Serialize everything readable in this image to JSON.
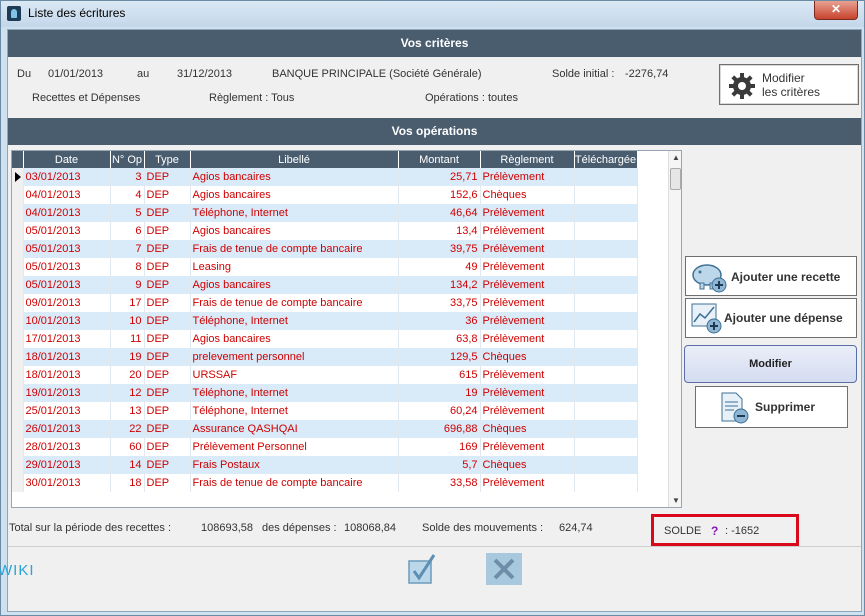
{
  "window": {
    "title": "Liste des écritures",
    "close_label": "✕"
  },
  "criteria": {
    "header": "Vos critères",
    "du_label": "Du",
    "du_value": "01/01/2013",
    "au_label": "au",
    "au_value": "31/12/2013",
    "bank": "BANQUE PRINCIPALE (Société Générale)",
    "solde_initial_label": "Solde initial :",
    "solde_initial_value": "-2276,74",
    "type": "Recettes et Dépenses",
    "reglement": "Règlement : Tous",
    "operations": "Opérations : toutes",
    "modify_button": "Modifier\nles critères"
  },
  "operations": {
    "header": "Vos opérations",
    "columns": [
      "Date",
      "N° Op",
      "Type",
      "Libellé",
      "Montant",
      "Règlement",
      "Téléchargée"
    ],
    "rows": [
      {
        "date": "03/01/2013",
        "op": "3",
        "type": "DEP",
        "libelle": "Agios bancaires",
        "montant": "25,71",
        "reglement": "Prélèvement"
      },
      {
        "date": "04/01/2013",
        "op": "4",
        "type": "DEP",
        "libelle": "Agios bancaires",
        "montant": "152,6",
        "reglement": "Chèques"
      },
      {
        "date": "04/01/2013",
        "op": "5",
        "type": "DEP",
        "libelle": "Téléphone, Internet",
        "montant": "46,64",
        "reglement": "Prélèvement"
      },
      {
        "date": "05/01/2013",
        "op": "6",
        "type": "DEP",
        "libelle": "Agios bancaires",
        "montant": "13,4",
        "reglement": "Prélèvement"
      },
      {
        "date": "05/01/2013",
        "op": "7",
        "type": "DEP",
        "libelle": "Frais de tenue de compte bancaire",
        "montant": "39,75",
        "reglement": "Prélèvement"
      },
      {
        "date": "05/01/2013",
        "op": "8",
        "type": "DEP",
        "libelle": "Leasing",
        "montant": "49",
        "reglement": "Prélèvement"
      },
      {
        "date": "05/01/2013",
        "op": "9",
        "type": "DEP",
        "libelle": "Agios bancaires",
        "montant": "134,2",
        "reglement": "Prélèvement"
      },
      {
        "date": "09/01/2013",
        "op": "17",
        "type": "DEP",
        "libelle": "Frais de tenue de compte bancaire",
        "montant": "33,75",
        "reglement": "Prélèvement"
      },
      {
        "date": "10/01/2013",
        "op": "10",
        "type": "DEP",
        "libelle": "Téléphone, Internet",
        "montant": "36",
        "reglement": "Prélèvement"
      },
      {
        "date": "17/01/2013",
        "op": "11",
        "type": "DEP",
        "libelle": "Agios bancaires",
        "montant": "63,8",
        "reglement": "Prélèvement"
      },
      {
        "date": "18/01/2013",
        "op": "19",
        "type": "DEP",
        "libelle": "prelevement personnel",
        "montant": "129,5",
        "reglement": "Chèques"
      },
      {
        "date": "18/01/2013",
        "op": "20",
        "type": "DEP",
        "libelle": "URSSAF",
        "montant": "615",
        "reglement": "Prélèvement"
      },
      {
        "date": "19/01/2013",
        "op": "12",
        "type": "DEP",
        "libelle": "Téléphone, Internet",
        "montant": "19",
        "reglement": "Prélèvement"
      },
      {
        "date": "25/01/2013",
        "op": "13",
        "type": "DEP",
        "libelle": "Téléphone, Internet",
        "montant": "60,24",
        "reglement": "Prélèvement"
      },
      {
        "date": "26/01/2013",
        "op": "22",
        "type": "DEP",
        "libelle": "Assurance QASHQAI",
        "montant": "696,88",
        "reglement": "Chèques"
      },
      {
        "date": "28/01/2013",
        "op": "60",
        "type": "DEP",
        "libelle": "Prélèvement Personnel",
        "montant": "169",
        "reglement": "Prélèvement"
      },
      {
        "date": "29/01/2013",
        "op": "14",
        "type": "DEP",
        "libelle": "Frais Postaux",
        "montant": "5,7",
        "reglement": "Chèques"
      },
      {
        "date": "30/01/2013",
        "op": "18",
        "type": "DEP",
        "libelle": "Frais de tenue de compte bancaire",
        "montant": "33,58",
        "reglement": "Prélèvement"
      }
    ]
  },
  "actions": {
    "add_income": "Ajouter une recette",
    "add_expense": "Ajouter une dépense",
    "modify": "Modifier",
    "delete": "Supprimer"
  },
  "totals": {
    "recettes_label": "Total sur la période des recettes :",
    "recettes_value": "108693,58",
    "depenses_label": "des dépenses :",
    "depenses_value": "108068,84",
    "mouvements_label": "Solde des mouvements :",
    "mouvements_value": "624,74",
    "solde_label": "SOLDE",
    "solde_help": "?",
    "solde_value": ": -1652"
  },
  "footer": {
    "brand": "WIKI"
  },
  "colors": {
    "header_bg": "#4a5d6f",
    "row_text": "#d00000",
    "row_alt": "#d9eaf8",
    "highlight_box": "#d9081a",
    "help_mark": "#8b18b3"
  }
}
